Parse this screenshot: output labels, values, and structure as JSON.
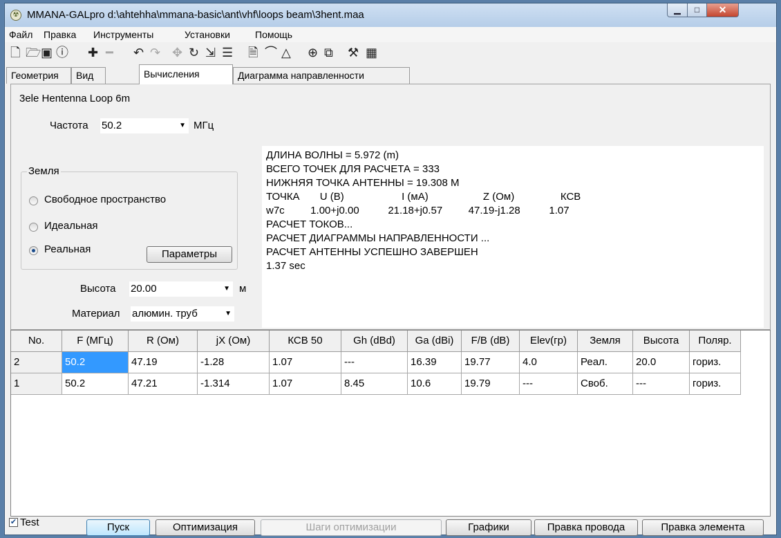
{
  "window": {
    "title": "MMANA-GALpro d:\\ahtehha\\mmana-basic\\ant\\vhf\\loops beam\\3hent.maa"
  },
  "menu": [
    "Файл",
    "Правка",
    "Инструменты",
    "Установки",
    "Помощь"
  ],
  "toolbar_icons": [
    "new-file-icon",
    "open-folder-icon",
    "save-disk-icon",
    "info-icon",
    "add-icon",
    "remove-icon",
    "undo-icon",
    "redo-icon",
    "move-icon",
    "rotate-icon",
    "import-icon",
    "wires-icon",
    "document-icon",
    "curve-icon",
    "triangle-icon",
    "crosshair-icon",
    "copy-icon",
    "tools-icon",
    "calculator-icon"
  ],
  "tabs": [
    "Геометрия",
    "Вид",
    "Вычисления",
    "Диаграмма направленности"
  ],
  "active_tab": "Вычисления",
  "calc": {
    "antenna_name": "3ele Hentenna Loop 6m",
    "freq_label": "Частота",
    "freq_value": "50.2",
    "freq_unit": "МГц",
    "ground_group": "Земля",
    "ground_options": [
      "Свободное пространство",
      "Идеальная",
      "Реальная"
    ],
    "ground_selected": "Реальная",
    "params_button": "Параметры",
    "height_label": "Высота",
    "height_value": "20.00",
    "height_unit": "м",
    "material_label": "Материал",
    "material_value": "алюмин. труб"
  },
  "output": [
    "ДЛИНА ВОЛНЫ = 5.972 (m)",
    "ВСЕГО ТОЧЕК ДЛЯ РАСЧЕТА = 333",
    "НИЖНЯЯ ТОЧКА АНТЕННЫ = 19.308 М",
    "ТОЧКА       U (B)                    I (мА)                   Z (Ом)                КСВ",
    "w7c         1.00+j0.00          21.18+j0.57         47.19-j1.28          1.07",
    "РАСЧЕТ ТОКОВ...",
    "РАСЧЕТ ДИАГРАММЫ НАПРАВЛЕННОСТИ ...",
    "РАСЧЕТ АНТЕННЫ УСПЕШНО ЗАВЕРШЕН",
    "1.37 sec"
  ],
  "table": {
    "columns": [
      "No.",
      "F (МГц)",
      "R (Ом)",
      "jX (Ом)",
      "КСВ 50",
      "Gh (dBd)",
      "Ga (dBi)",
      "F/B (dB)",
      "Elev(гр)",
      "Земля",
      "Высота",
      "Поляр."
    ],
    "rows": [
      [
        "2",
        "50.2",
        "47.19",
        "-1.28",
        "1.07",
        "---",
        "16.39",
        "19.77",
        "4.0",
        "Реал.",
        "20.0",
        "гориз."
      ],
      [
        "1",
        "50.2",
        "47.21",
        "-1.314",
        "1.07",
        "8.45",
        "10.6",
        "19.79",
        "---",
        "Своб.",
        "---",
        "гориз."
      ]
    ]
  },
  "bottom": {
    "test_label": "Test",
    "test_checked": true,
    "buttons": [
      "Пуск",
      "Оптимизация",
      "Шаги оптимизации",
      "Графики",
      "Правка провода",
      "Правка элемента"
    ]
  }
}
